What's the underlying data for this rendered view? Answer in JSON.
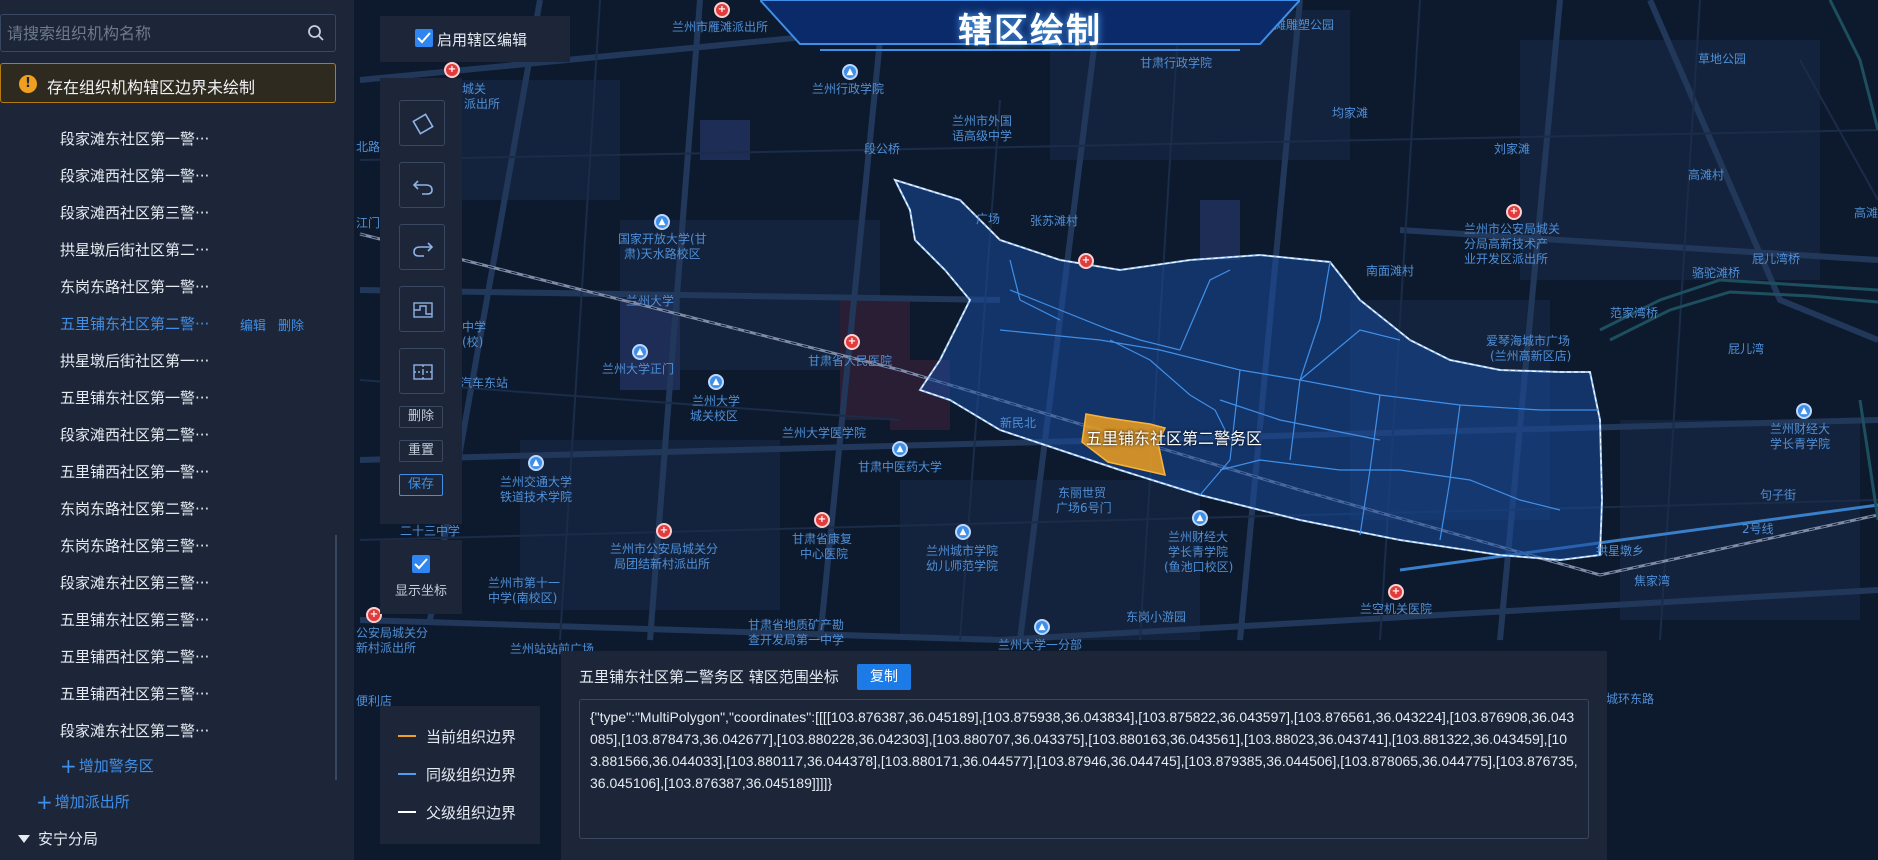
{
  "title": "辖区绘制",
  "sidebar": {
    "search_placeholder": "请搜索组织机构名称",
    "warning": "存在组织机构辖区边界未绘制",
    "items": [
      "段家滩东社区第一警···",
      "段家滩西社区第一警···",
      "段家滩西社区第三警···",
      "拱星墩后街社区第二···",
      "东岗东路社区第一警···",
      "五里铺东社区第二警···",
      "拱星墩后街社区第一···",
      "五里铺东社区第一警···",
      "段家滩西社区第二警···",
      "五里铺西社区第一警···",
      "东岗东路社区第二警···",
      "东岗东路社区第三警···",
      "段家滩东社区第三警···",
      "五里铺东社区第三警···",
      "五里铺西社区第二警···",
      "五里铺西社区第三警···",
      "段家滩东社区第二警···"
    ],
    "active_index": 5,
    "edit_label": "编辑",
    "delete_label": "删除",
    "add_area": "增加警务区",
    "add_station": "增加派出所",
    "branch": "安宁分局"
  },
  "tools": {
    "enable_edit": "启用辖区编辑",
    "enable_edit_checked": true,
    "delete": "删除",
    "reset": "重置",
    "save": "保存",
    "show_coords": "显示坐标",
    "show_coords_checked": true,
    "icons": [
      "polygon-draw-icon",
      "undo-icon",
      "redo-icon",
      "merge-icon",
      "split-icon"
    ]
  },
  "legend": [
    {
      "label": "当前组织边界",
      "color": "#f0a020"
    },
    {
      "label": "同级组织边界",
      "color": "#4f9cf0"
    },
    {
      "label": "父级组织边界",
      "color": "#ffffff"
    }
  ],
  "coords": {
    "title": "五里铺东社区第二警务区 辖区范围坐标",
    "copy": "复制",
    "text": "{\"type\":\"MultiPolygon\",\"coordinates\":[[[[103.876387,36.045189],[103.875938,36.043834],[103.875822,36.043597],[103.876561,36.043224],[103.876908,36.043085],[103.878473,36.042677],[103.880228,36.042303],[103.880707,36.043375],[103.880163,36.043561],[103.88023,36.043741],[103.881322,36.043459],[103.881566,36.044033],[103.880117,36.044378],[103.880171,36.044577],[103.87946,36.044745],[103.879385,36.044506],[103.878065,36.044775],[103.876735,36.045106],[103.876387,36.045189]]]]}"
  },
  "map": {
    "highlight_label": "五里铺东社区第二警务区",
    "labels": [
      "兰州市雁滩派出所",
      "雁滩雕塑公园",
      "甘肃行政学院",
      "兰州行政学院",
      "草地公园",
      "城关",
      "派出所",
      "兰州市外国",
      "语高级中学",
      "均家滩",
      "段公桥",
      "刘家滩",
      "高滩村",
      "国家开放大学(甘",
      "肃)天水路校区",
      "张苏滩村",
      "兰州市公安局城关",
      "分局高新技术产",
      "业开发区派出所",
      "广场",
      "南面滩村",
      "屁儿湾桥",
      "骆驼滩桥",
      "高滩",
      "兰州大学",
      "范家湾桥",
      "甘肃省人民医院",
      "爱琴海城市广场",
      "(兰州高新区店)",
      "屁儿湾",
      "兰州大学正门",
      "兰州大学",
      "城关校区",
      "兰州大学医学院",
      "新民北",
      "甘肃中医药大学",
      "兰州财经大",
      "学长青学院",
      "兰州交通大学",
      "铁道技术学院",
      "东丽世贸",
      "广场6号门",
      "句子街",
      "二十三中学",
      "兰州市公安局城关分",
      "局团结新村派出所",
      "甘肃省康复",
      "中心医院",
      "兰州城市学院",
      "幼儿师范学院",
      "兰州财经大",
      "学长青学院",
      "(鱼池口校区)",
      "拱星墩乡",
      "焦家湾",
      "兰州市第十一",
      "中学(南校区)",
      "兰空机关医院",
      "东岗小游园",
      "甘肃省地质矿产勘",
      "查开发局第一中学",
      "兰州大学一分部",
      "兰州站站前广场",
      "城环东路",
      "公安局城关分",
      "新村派出所",
      "便利店",
      "汽车东站",
      "中学",
      "(校)",
      "北路",
      "江门",
      "2号线"
    ]
  }
}
